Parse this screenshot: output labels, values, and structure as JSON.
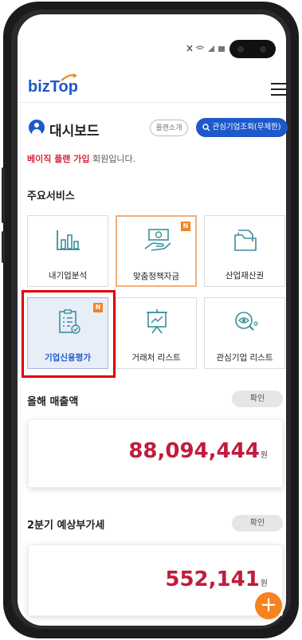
{
  "header": {
    "logo_text": "bizTop"
  },
  "dashboard": {
    "title": "대시보드",
    "plan_button": "플랜소개",
    "search_button": "관심기업조회(무제한)",
    "member_plan": "베이직 플랜 가입",
    "member_suffix": " 회원입니다."
  },
  "services": {
    "title": "주요서비스",
    "tiles": [
      {
        "label": "내기업분석",
        "icon": "bar-chart-icon",
        "badge": ""
      },
      {
        "label": "맞춤정책자금",
        "icon": "money-hand-icon",
        "badge": "N"
      },
      {
        "label": "산업재산권",
        "icon": "folder-icon",
        "badge": ""
      },
      {
        "label": "기업신용평가",
        "icon": "clipboard-check-icon",
        "badge": "N"
      },
      {
        "label": "거래처 리스트",
        "icon": "presentation-chart-icon",
        "badge": ""
      },
      {
        "label": "관심기업 리스트",
        "icon": "search-eye-icon",
        "badge": ""
      }
    ]
  },
  "sales": {
    "title": "올해 매출액",
    "confirm": "확인",
    "amount": "88,094,444",
    "unit": "원"
  },
  "vat": {
    "title": "2분기 예상부가세",
    "confirm": "확인",
    "amount": "552,141",
    "unit": "원"
  },
  "fab": {
    "symbol": "+"
  },
  "colors": {
    "brand": "#1f58c8",
    "accent": "#f5831f",
    "amount": "#c01c3d",
    "highlight_box": "#e00000"
  }
}
